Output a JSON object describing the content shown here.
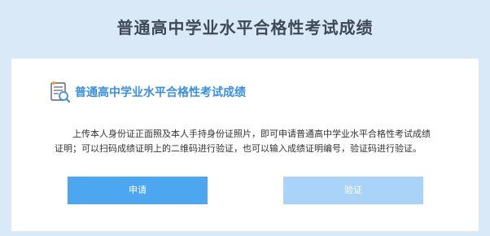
{
  "page": {
    "title": "普通高中学业水平合格性考试成绩"
  },
  "card": {
    "section_title": "普通高中学业水平合格性考试成绩",
    "section_icon": "certificate-search-icon",
    "description": "上传本人身份证正面照及本人手持身份证照片，即可申请普通高中学业水平合格性考试成绩证明；可以扫码成绩证明上的二维码进行验证，也可以输入成绩证明编号，验证码进行验证。",
    "apply_label": "申请",
    "verify_label": "验证"
  },
  "colors": {
    "background": "#d9e9f7",
    "accent": "#3b8fe0",
    "primary_button": "#4da7f0",
    "secondary_button": "#a9d3f7"
  }
}
